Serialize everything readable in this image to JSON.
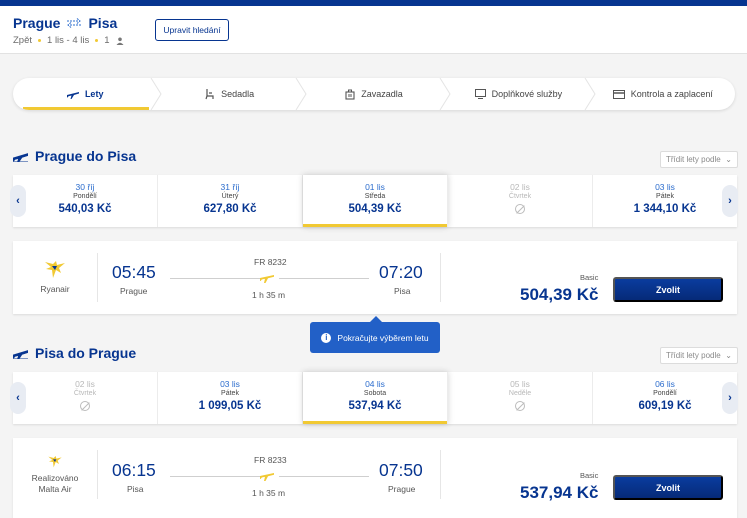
{
  "header": {
    "origin": "Prague",
    "destination": "Pisa",
    "trip_type": "Zpět",
    "dates": "1 lis - 4 lis",
    "passengers": "1",
    "edit_label": "Upravit hledání"
  },
  "steps": [
    {
      "label": "Lety",
      "icon": "plane-icon",
      "active": true
    },
    {
      "label": "Sedadla",
      "icon": "seat-icon",
      "active": false
    },
    {
      "label": "Zavazadla",
      "icon": "luggage-icon",
      "active": false
    },
    {
      "label": "Doplňkové služby",
      "icon": "monitor-icon",
      "active": false
    },
    {
      "label": "Kontrola a zaplacení",
      "icon": "card-icon",
      "active": false
    }
  ],
  "outbound": {
    "title": "Prague do Pisa",
    "sort_label": "Třídit lety podle",
    "dates": [
      {
        "date": "30 říj",
        "weekday": "Pondělí",
        "price": "540,03 Kč",
        "available": true,
        "selected": false
      },
      {
        "date": "31 říj",
        "weekday": "Úterý",
        "price": "627,80 Kč",
        "available": true,
        "selected": false
      },
      {
        "date": "01 lis",
        "weekday": "Středa",
        "price": "504,39 Kč",
        "available": true,
        "selected": true
      },
      {
        "date": "02 lis",
        "weekday": "Čtvrtek",
        "price": "",
        "available": false,
        "selected": false
      },
      {
        "date": "03 lis",
        "weekday": "Pátek",
        "price": "1 344,10 Kč",
        "available": true,
        "selected": false
      }
    ],
    "flight": {
      "airline": "Ryanair",
      "depart_time": "05:45",
      "depart_city": "Prague",
      "flight_no": "FR 8232",
      "duration": "1 h 35 m",
      "arrive_time": "07:20",
      "arrive_city": "Pisa",
      "fare": "Basic",
      "price": "504,39 Kč",
      "select_label": "Zvolit"
    }
  },
  "tooltip": {
    "text": "Pokračujte výběrem letu"
  },
  "inbound": {
    "title": "Pisa do Prague",
    "sort_label": "Třídit lety podle",
    "dates": [
      {
        "date": "02 lis",
        "weekday": "Čtvrtek",
        "price": "",
        "available": false,
        "selected": false
      },
      {
        "date": "03 lis",
        "weekday": "Pátek",
        "price": "1 099,05 Kč",
        "available": true,
        "selected": false
      },
      {
        "date": "04 lis",
        "weekday": "Sobota",
        "price": "537,94 Kč",
        "available": true,
        "selected": true
      },
      {
        "date": "05 lis",
        "weekday": "Neděle",
        "price": "",
        "available": false,
        "selected": false
      },
      {
        "date": "06 lis",
        "weekday": "Pondělí",
        "price": "609,19 Kč",
        "available": true,
        "selected": false
      }
    ],
    "flight": {
      "airline_line1": "Realizováno",
      "airline_line2": "Malta Air",
      "depart_time": "06:15",
      "depart_city": "Pisa",
      "flight_no": "FR 8233",
      "duration": "1 h 35 m",
      "arrive_time": "07:50",
      "arrive_city": "Prague",
      "fare": "Basic",
      "price": "537,94 Kč",
      "select_label": "Zvolit"
    }
  },
  "colors": {
    "brand": "#073590",
    "accent": "#f1c933",
    "link": "#2260c7"
  }
}
